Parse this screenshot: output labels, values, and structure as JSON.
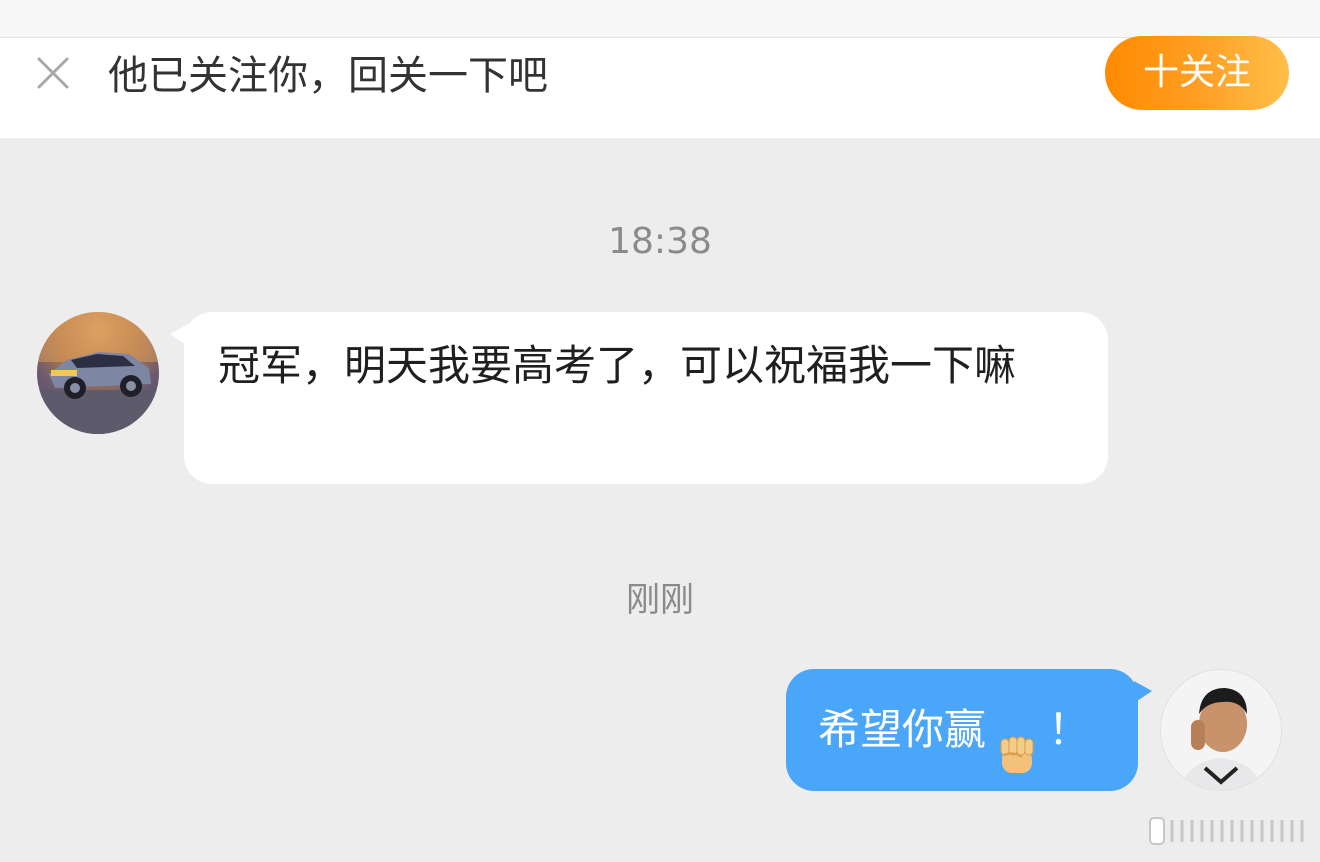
{
  "follow_bar": {
    "prompt": "他已关注你，回关一下吧",
    "follow_button": "十关注",
    "close_icon": "close-icon"
  },
  "messages": [
    {
      "type": "timestamp",
      "text": "18:38"
    },
    {
      "type": "incoming",
      "text": "冠军，明天我要高考了，可以祝福我一下嘛",
      "avatar": "race-car-avatar"
    },
    {
      "type": "timestamp",
      "text": "刚刚"
    },
    {
      "type": "outgoing",
      "text_before": "希望你赢",
      "emoji": "raised-fist-emoji",
      "text_after": "！",
      "avatar": "user-photo-avatar"
    }
  ],
  "colors": {
    "background": "#ededed",
    "follow_button_gradient_start": "#ff8a00",
    "follow_button_gradient_end": "#ffbf4a",
    "outgoing_bubble": "#4aa6f8",
    "incoming_bubble": "#ffffff"
  }
}
